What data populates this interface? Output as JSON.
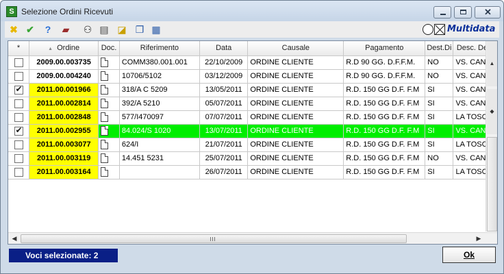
{
  "window": {
    "title": "Selezione Ordini Ricevuti",
    "app_icon": "S"
  },
  "toolbar": {
    "icons": [
      "cross-icon",
      "check-icon",
      "help-icon",
      "book-icon",
      "binoculars-icon",
      "print-preview-icon",
      "edit-icon",
      "windows-icon",
      "properties-icon"
    ],
    "brand": "Multidata"
  },
  "grid": {
    "columns": [
      "*",
      "Ordine",
      "Doc.",
      "Riferimento",
      "Data",
      "Causale",
      "Pagamento",
      "Dest.Di",
      "Desc. Dest"
    ],
    "sort_indicator": "▲",
    "rows": [
      {
        "checked": false,
        "ordine": "2009.00.003735",
        "highlight": false,
        "riferimento": "COMM380.001.001",
        "data": "22/10/2009",
        "causale": "ORDINE CLIENTE",
        "pagamento": "R.D 90 GG. D.F.F.M.",
        "dest": "NO",
        "desc_dest": "VS. CANTI"
      },
      {
        "checked": false,
        "ordine": "2009.00.004240",
        "highlight": false,
        "riferimento": "10706/5102",
        "data": "03/12/2009",
        "causale": "ORDINE CLIENTE",
        "pagamento": "R.D 90 GG. D.F.F.M.",
        "dest": "NO",
        "desc_dest": "VS. CANTI"
      },
      {
        "checked": true,
        "ordine": "2011.00.001966",
        "highlight": true,
        "riferimento": "318/A C 5209",
        "data": "13/05/2011",
        "causale": "ORDINE CLIENTE",
        "pagamento": "R.D. 150 GG D.F. F.M",
        "dest": "SI",
        "desc_dest": "VS. CANTI"
      },
      {
        "checked": false,
        "ordine": "2011.00.002814",
        "highlight": true,
        "riferimento": "392/A 5210",
        "data": "05/07/2011",
        "causale": "ORDINE CLIENTE",
        "pagamento": "R.D. 150 GG D.F. F.M",
        "dest": "SI",
        "desc_dest": "VS. CANTI"
      },
      {
        "checked": false,
        "ordine": "2011.00.002848",
        "highlight": true,
        "riferimento": "577/I470097",
        "data": "07/07/2011",
        "causale": "ORDINE CLIENTE",
        "pagamento": "R.D. 150 GG D.F. F.M",
        "dest": "SI",
        "desc_dest": "LA TOSCAI"
      },
      {
        "checked": true,
        "ordine": "2011.00.002955",
        "highlight": true,
        "selected": true,
        "riferimento": "84.024/S 1020",
        "data": "13/07/2011",
        "causale": "ORDINE CLIENTE",
        "pagamento": "R.D. 150 GG D.F. F.M",
        "dest": "SI",
        "desc_dest": "VS. CANTI"
      },
      {
        "checked": false,
        "ordine": "2011.00.003077",
        "highlight": true,
        "riferimento": "624/I",
        "data": "21/07/2011",
        "causale": "ORDINE CLIENTE",
        "pagamento": "R.D. 150 GG D.F. F.M",
        "dest": "SI",
        "desc_dest": "LA TOSCAI"
      },
      {
        "checked": false,
        "ordine": "2011.00.003119",
        "highlight": true,
        "riferimento": "14.451 5231",
        "data": "25/07/2011",
        "causale": "ORDINE CLIENTE",
        "pagamento": "R.D. 150 GG D.F. F.M",
        "dest": "NO",
        "desc_dest": "VS. CANTI"
      },
      {
        "checked": false,
        "ordine": "2011.00.003164",
        "highlight": true,
        "riferimento": "",
        "data": "26/07/2011",
        "causale": "ORDINE CLIENTE",
        "pagamento": "R.D. 150 GG D.F. F.M",
        "dest": "SI",
        "desc_dest": "LA TOSCAI"
      }
    ]
  },
  "footer": {
    "counter": "Voci selezionate: 2",
    "ok_label": "Ok"
  },
  "colors": {
    "highlight": "#ffff00",
    "selected_row": "#00ee00",
    "counter_bg": "#0a1f86"
  }
}
